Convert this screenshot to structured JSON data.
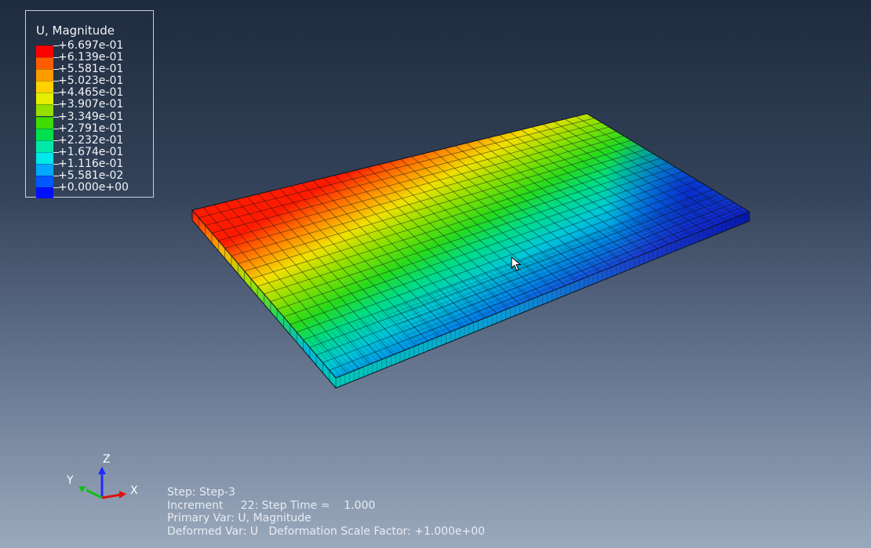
{
  "legend": {
    "title": "U, Magnitude",
    "entries": [
      {
        "label": "+6.697e-01",
        "color": "#ff0000"
      },
      {
        "label": "+6.139e-01",
        "color": "#ff5c00"
      },
      {
        "label": "+5.581e-01",
        "color": "#ff9a00"
      },
      {
        "label": "+5.023e-01",
        "color": "#ffd200"
      },
      {
        "label": "+4.465e-01",
        "color": "#e4f000"
      },
      {
        "label": "+3.907e-01",
        "color": "#96e000"
      },
      {
        "label": "+3.349e-01",
        "color": "#3edc00"
      },
      {
        "label": "+2.791e-01",
        "color": "#00e04e"
      },
      {
        "label": "+2.232e-01",
        "color": "#00e8a8"
      },
      {
        "label": "+1.674e-01",
        "color": "#00e8e8"
      },
      {
        "label": "+1.116e-01",
        "color": "#00a8ff"
      },
      {
        "label": "+5.581e-02",
        "color": "#0058ff"
      },
      {
        "label": "+0.000e+00",
        "color": "#0010ff"
      }
    ]
  },
  "triad": {
    "x": "X",
    "y": "Y",
    "z": "Z"
  },
  "status": {
    "step": "Step: Step-3",
    "increment": "Increment     22: Step Time =    1.000",
    "primary_var": "Primary Var: U, Magnitude",
    "deformed_var": "Deformed Var: U   Deformation Scale Factor: +1.000e+00"
  }
}
